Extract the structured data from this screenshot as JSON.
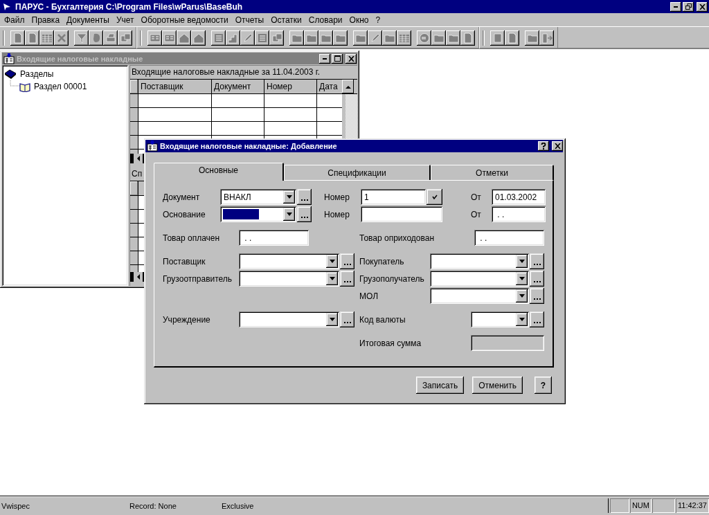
{
  "app_window": {
    "title": "ПАРУС - Бухгалтерия  C:\\Program Files\\wParus\\BaseBuh"
  },
  "menu": [
    "Файл",
    "Правка",
    "Документы",
    "Учет",
    "Оборотные ведомости",
    "Отчеты",
    "Остатки",
    "Словари",
    "Окно",
    "?"
  ],
  "child_window": {
    "title": "Входящие налоговые накладные",
    "active": false,
    "tree": [
      {
        "label": "Разделы",
        "expanded": true,
        "children": [
          {
            "label": "Раздел 00001"
          }
        ]
      }
    ],
    "grid_caption": "Входящие налоговые накладные за 11.04.2003 г.",
    "columns": [
      "Поставщик",
      "Документ",
      "Номер",
      "Дата"
    ],
    "lower_caption": "Сп"
  },
  "dialog": {
    "title": "Входящие налоговые накладные: Добавление",
    "tabs": [
      {
        "label": "Основные",
        "selected": true
      },
      {
        "label": "Спецификации",
        "selected": false
      },
      {
        "label": "Отметки",
        "selected": false
      }
    ],
    "sections": [
      [
        {
          "left": {
            "label": "Документ",
            "kind": "combo",
            "value": "ВНАКЛ"
          },
          "middle": {
            "label": "Номер",
            "kind": "number",
            "value": "1"
          },
          "right": {
            "label": "От",
            "kind": "text",
            "value": "01.03.2002"
          }
        },
        {
          "left": {
            "label": "Основание",
            "kind": "combo",
            "highlighted": true
          },
          "middle": {
            "label": "Номер",
            "kind": "text"
          },
          "right": {
            "label": "От",
            "kind": "text",
            "value": " . ."
          }
        }
      ],
      [
        {
          "left": {
            "label": "Товар оплачен",
            "kind": "text",
            "value": " . ."
          },
          "right": {
            "label": "Товар оприходован",
            "kind": "text",
            "value": " . ."
          }
        }
      ],
      [
        {
          "left": {
            "label": "Поставщик",
            "kind": "combo"
          },
          "right": {
            "label": "Покупатель",
            "kind": "combo"
          }
        },
        {
          "left": {
            "label": "Грузоотправитель",
            "kind": "combo"
          },
          "right": {
            "label": "Грузополучатель",
            "kind": "combo"
          }
        },
        {
          "right": {
            "label": "МОЛ",
            "kind": "combo"
          }
        }
      ],
      [
        {
          "left": {
            "label": "Учреждение",
            "kind": "combo"
          },
          "right": {
            "label": "Код валюты",
            "kind": "combo"
          }
        }
      ],
      [
        {
          "right": {
            "label": "Итоговая сумма",
            "kind": "readonly"
          }
        }
      ]
    ],
    "buttons": [
      {
        "label": "Записать",
        "kind": "text"
      },
      {
        "label": "Отменить",
        "kind": "text"
      },
      {
        "label": "?",
        "kind": "help"
      }
    ]
  },
  "status_bar": {
    "panes": [
      "Vwispec",
      "Record: None",
      "Exclusive"
    ],
    "indicators": [
      {
        "kind": "blank"
      },
      {
        "kind": "text",
        "text": "NUM"
      },
      {
        "kind": "blank"
      },
      {
        "kind": "text",
        "text": "11:42:37"
      }
    ]
  }
}
